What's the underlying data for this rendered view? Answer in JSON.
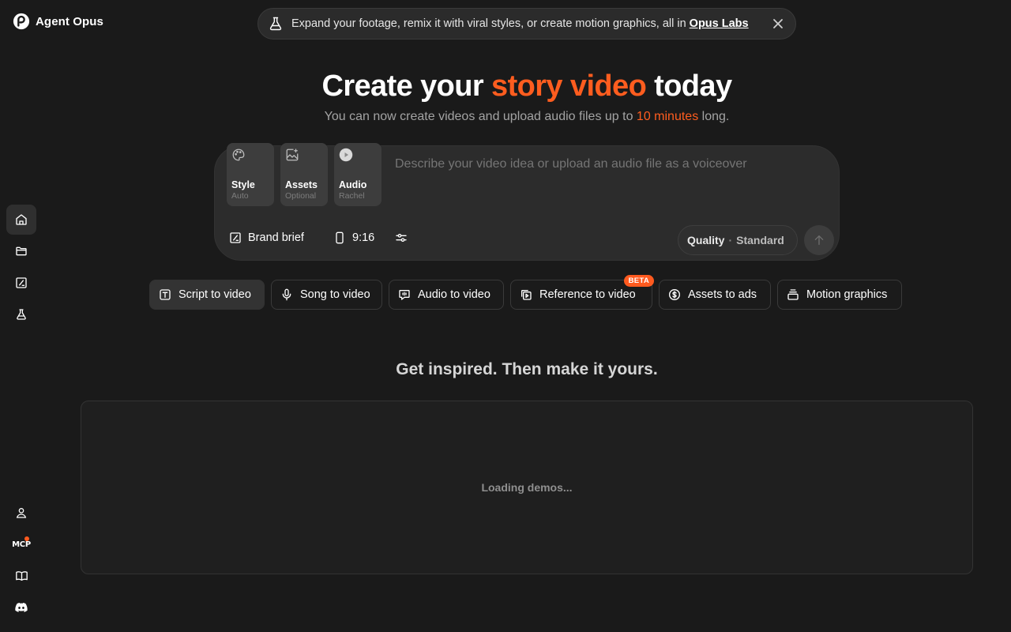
{
  "app": {
    "name": "Agent Opus"
  },
  "banner": {
    "text": "Expand your footage, remix it with viral styles, or create motion graphics, all in",
    "link": "Opus Labs",
    "icon": "flask-icon",
    "close_icon": "close-icon"
  },
  "sidebar": {
    "top_items": [
      {
        "name": "home",
        "icon": "home-icon",
        "active": true
      },
      {
        "name": "projects",
        "icon": "folder-icon"
      },
      {
        "name": "brand",
        "icon": "brand-kit-icon"
      },
      {
        "name": "labs",
        "icon": "flask-icon"
      }
    ],
    "bottom_items": [
      {
        "name": "account",
        "icon": "user-icon"
      },
      {
        "name": "mcp",
        "label": "MCP",
        "notification": true
      },
      {
        "name": "docs",
        "icon": "book-icon"
      },
      {
        "name": "discord",
        "icon": "discord-icon"
      }
    ]
  },
  "hero": {
    "title_prefix": "Create your ",
    "title_accent": "story video",
    "title_suffix": " today",
    "sub_prefix": "You can now create videos and upload audio files up to ",
    "sub_accent": "10 minutes",
    "sub_suffix": " long."
  },
  "prompt": {
    "placeholder": "Describe your video idea or upload an audio file as a voiceover",
    "chips": [
      {
        "label": "Style",
        "sub": "Auto",
        "icon": "palette-icon"
      },
      {
        "label": "Assets",
        "sub": "Optional",
        "icon": "image-add-icon"
      },
      {
        "label": "Audio",
        "sub": "Rachel",
        "icon": "play-circle-icon"
      }
    ],
    "brand_brief": "Brand brief",
    "aspect_ratio": "9:16",
    "quality_label": "Quality",
    "quality_separator": "·",
    "quality_value": "Standard"
  },
  "modes": [
    {
      "label": "Script to video",
      "icon": "text-box-icon",
      "active": true
    },
    {
      "label": "Song to video",
      "icon": "microphone-icon"
    },
    {
      "label": "Audio to video",
      "icon": "speech-bubble-icon"
    },
    {
      "label": "Reference to video",
      "icon": "copy-play-icon",
      "badge": "BETA"
    },
    {
      "label": "Assets to ads",
      "icon": "dollar-circle-icon"
    },
    {
      "label": "Motion graphics",
      "icon": "layers-icon"
    }
  ],
  "inspire": {
    "title": "Get inspired. Then make it yours.",
    "loading": "Loading demos..."
  },
  "colors": {
    "accent": "#ff5d1f",
    "background": "#1a1a1a"
  }
}
